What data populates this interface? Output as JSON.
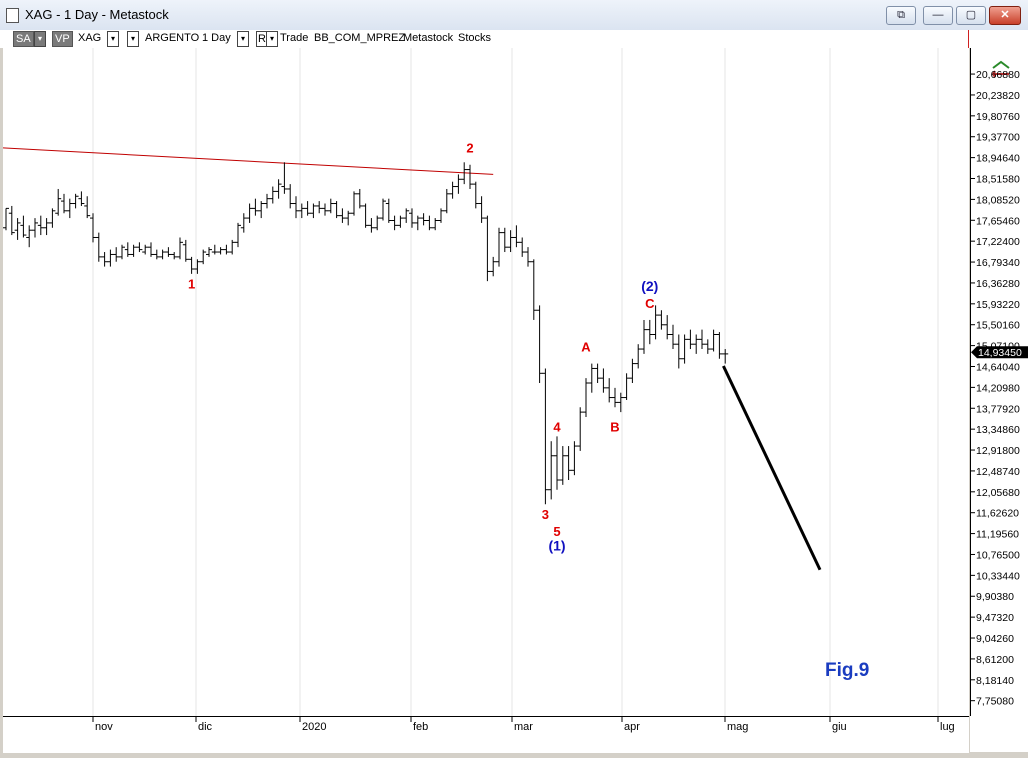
{
  "window": {
    "title": "XAG - 1 Day - Metastock",
    "buttons": [
      "⧉",
      "—",
      "▢",
      "✕"
    ]
  },
  "toolbar": {
    "sa": "SA",
    "vp": "VP",
    "symbol": "XAG",
    "name": "ARGENTO",
    "period": "1 Day",
    "r": "R",
    "trade": "Trade",
    "layout": "BB_COM_MPREZ",
    "source": "Metastock",
    "type": "Stocks"
  },
  "chart_data": {
    "type": "ohlc",
    "title": "",
    "y_ticks": [
      "20,66880",
      "20,23820",
      "19,80760",
      "19,37700",
      "18,94640",
      "18,51580",
      "18,08520",
      "17,65460",
      "17,22400",
      "16,79340",
      "16,36280",
      "15,93220",
      "15,50160",
      "15,07100",
      "14,64040",
      "14,20980",
      "13,77920",
      "13,34860",
      "12,91800",
      "12,48740",
      "12,05680",
      "11,62620",
      "11,19560",
      "10,76500",
      "10,33440",
      "9,90380",
      "9,47320",
      "9,04260",
      "8,61200",
      "8,18140",
      "7,75080"
    ],
    "ylim": [
      7.6,
      21.0
    ],
    "current_price": "14,93450",
    "x_labels": [
      "nov",
      "dic",
      "2020",
      "feb",
      "mar",
      "apr",
      "mag",
      "giu",
      "lug"
    ],
    "bars": [
      [
        17.5,
        17.9,
        17.45,
        17.9
      ],
      [
        17.8,
        17.95,
        17.35,
        17.4
      ],
      [
        17.45,
        17.7,
        17.25,
        17.6
      ],
      [
        17.55,
        17.75,
        17.3,
        17.35
      ],
      [
        17.3,
        17.55,
        17.1,
        17.45
      ],
      [
        17.45,
        17.7,
        17.3,
        17.6
      ],
      [
        17.55,
        17.75,
        17.35,
        17.5
      ],
      [
        17.5,
        17.7,
        17.35,
        17.6
      ],
      [
        17.6,
        17.9,
        17.5,
        17.85
      ],
      [
        17.8,
        18.3,
        17.75,
        18.1
      ],
      [
        18.05,
        18.2,
        17.8,
        17.85
      ],
      [
        17.85,
        18.1,
        17.7,
        18.0
      ],
      [
        18.0,
        18.2,
        17.9,
        18.15
      ],
      [
        18.1,
        18.25,
        17.95,
        18.0
      ],
      [
        17.95,
        18.15,
        17.7,
        17.75
      ],
      [
        17.7,
        17.8,
        17.2,
        17.3
      ],
      [
        17.3,
        17.4,
        16.8,
        16.9
      ],
      [
        16.9,
        17.0,
        16.7,
        16.8
      ],
      [
        16.8,
        17.05,
        16.7,
        16.95
      ],
      [
        16.95,
        17.1,
        16.8,
        16.9
      ],
      [
        16.9,
        17.15,
        16.85,
        17.1
      ],
      [
        17.05,
        17.2,
        16.9,
        16.95
      ],
      [
        16.95,
        17.15,
        16.9,
        17.1
      ],
      [
        17.1,
        17.2,
        17.0,
        17.05
      ],
      [
        17.0,
        17.15,
        16.95,
        17.1
      ],
      [
        17.1,
        17.2,
        16.9,
        16.95
      ],
      [
        16.95,
        17.05,
        16.85,
        16.9
      ],
      [
        16.9,
        17.05,
        16.85,
        17.0
      ],
      [
        17.0,
        17.1,
        16.9,
        16.95
      ],
      [
        16.95,
        17.0,
        16.85,
        16.9
      ],
      [
        16.9,
        17.3,
        16.85,
        17.2
      ],
      [
        17.15,
        17.25,
        16.8,
        16.85
      ],
      [
        16.85,
        16.9,
        16.55,
        16.65
      ],
      [
        16.65,
        16.85,
        16.55,
        16.8
      ],
      [
        16.8,
        17.05,
        16.75,
        17.0
      ],
      [
        16.95,
        17.1,
        16.9,
        17.05
      ],
      [
        17.0,
        17.15,
        16.95,
        17.0
      ],
      [
        17.0,
        17.1,
        16.95,
        17.05
      ],
      [
        17.05,
        17.15,
        16.95,
        17.0
      ],
      [
        17.0,
        17.25,
        16.95,
        17.2
      ],
      [
        17.2,
        17.6,
        17.1,
        17.55
      ],
      [
        17.5,
        17.8,
        17.4,
        17.7
      ],
      [
        17.7,
        18.0,
        17.6,
        17.9
      ],
      [
        17.9,
        18.1,
        17.75,
        17.85
      ],
      [
        17.85,
        18.05,
        17.7,
        18.0
      ],
      [
        18.0,
        18.2,
        17.9,
        18.1
      ],
      [
        18.1,
        18.35,
        18.0,
        18.25
      ],
      [
        18.25,
        18.5,
        18.1,
        18.4
      ],
      [
        18.35,
        18.85,
        18.2,
        18.3
      ],
      [
        18.3,
        18.4,
        17.9,
        18.0
      ],
      [
        18.0,
        18.15,
        17.7,
        17.85
      ],
      [
        17.85,
        18.0,
        17.7,
        17.9
      ],
      [
        17.9,
        18.05,
        17.75,
        17.8
      ],
      [
        17.8,
        18.0,
        17.7,
        17.95
      ],
      [
        17.95,
        18.05,
        17.8,
        17.9
      ],
      [
        17.9,
        18.0,
        17.75,
        17.85
      ],
      [
        17.85,
        18.1,
        17.8,
        18.0
      ],
      [
        18.0,
        18.05,
        17.7,
        17.75
      ],
      [
        17.75,
        17.9,
        17.6,
        17.7
      ],
      [
        17.7,
        17.85,
        17.55,
        17.8
      ],
      [
        17.8,
        18.25,
        17.75,
        18.2
      ],
      [
        18.2,
        18.3,
        17.9,
        17.95
      ],
      [
        17.95,
        18.0,
        17.5,
        17.55
      ],
      [
        17.55,
        17.7,
        17.4,
        17.5
      ],
      [
        17.5,
        17.75,
        17.45,
        17.7
      ],
      [
        17.7,
        18.1,
        17.65,
        18.05
      ],
      [
        18.0,
        18.1,
        17.6,
        17.65
      ],
      [
        17.65,
        17.75,
        17.45,
        17.55
      ],
      [
        17.55,
        17.75,
        17.5,
        17.7
      ],
      [
        17.7,
        17.9,
        17.6,
        17.85
      ],
      [
        17.8,
        17.9,
        17.5,
        17.6
      ],
      [
        17.6,
        17.75,
        17.45,
        17.7
      ],
      [
        17.7,
        17.8,
        17.55,
        17.65
      ],
      [
        17.65,
        17.75,
        17.45,
        17.5
      ],
      [
        17.5,
        17.7,
        17.45,
        17.65
      ],
      [
        17.65,
        17.9,
        17.6,
        17.85
      ],
      [
        17.85,
        18.3,
        17.8,
        18.2
      ],
      [
        18.2,
        18.45,
        18.1,
        18.35
      ],
      [
        18.35,
        18.6,
        18.2,
        18.5
      ],
      [
        18.5,
        18.85,
        18.4,
        18.7
      ],
      [
        18.7,
        18.8,
        18.3,
        18.4
      ],
      [
        18.4,
        18.45,
        17.9,
        18.0
      ],
      [
        18.0,
        18.15,
        17.6,
        17.7
      ],
      [
        17.7,
        17.75,
        16.4,
        16.6
      ],
      [
        16.6,
        16.9,
        16.5,
        16.8
      ],
      [
        16.8,
        17.5,
        16.7,
        17.4
      ],
      [
        17.4,
        17.5,
        17.0,
        17.1
      ],
      [
        17.1,
        17.45,
        17.0,
        17.3
      ],
      [
        17.3,
        17.55,
        17.1,
        17.2
      ],
      [
        17.2,
        17.3,
        16.9,
        17.0
      ],
      [
        17.0,
        17.1,
        16.7,
        16.8
      ],
      [
        16.8,
        16.85,
        15.6,
        15.8
      ],
      [
        15.8,
        15.9,
        14.3,
        14.5
      ],
      [
        14.5,
        14.6,
        11.8,
        12.1
      ],
      [
        12.1,
        13.1,
        11.9,
        12.8
      ],
      [
        12.8,
        13.2,
        12.1,
        12.3
      ],
      [
        12.3,
        13.0,
        12.2,
        12.8
      ],
      [
        12.8,
        13.0,
        12.3,
        12.5
      ],
      [
        12.5,
        13.1,
        12.4,
        13.0
      ],
      [
        13.0,
        13.8,
        12.9,
        13.7
      ],
      [
        13.7,
        14.4,
        13.6,
        14.3
      ],
      [
        14.3,
        14.7,
        14.1,
        14.6
      ],
      [
        14.6,
        14.7,
        14.3,
        14.4
      ],
      [
        14.4,
        14.6,
        14.1,
        14.2
      ],
      [
        14.2,
        14.4,
        13.9,
        14.0
      ],
      [
        14.0,
        14.2,
        13.8,
        13.9
      ],
      [
        13.9,
        14.1,
        13.7,
        14.0
      ],
      [
        14.0,
        14.5,
        13.95,
        14.4
      ],
      [
        14.4,
        14.8,
        14.3,
        14.7
      ],
      [
        14.7,
        15.1,
        14.6,
        15.0
      ],
      [
        15.0,
        15.6,
        14.9,
        15.4
      ],
      [
        15.4,
        15.6,
        15.1,
        15.3
      ],
      [
        15.3,
        15.9,
        15.2,
        15.7
      ],
      [
        15.7,
        15.8,
        15.4,
        15.5
      ],
      [
        15.5,
        15.7,
        15.2,
        15.3
      ],
      [
        15.3,
        15.5,
        15.0,
        15.1
      ],
      [
        15.1,
        15.3,
        14.6,
        14.8
      ],
      [
        14.8,
        15.3,
        14.7,
        15.2
      ],
      [
        15.2,
        15.4,
        15.0,
        15.1
      ],
      [
        15.1,
        15.3,
        14.9,
        15.2
      ],
      [
        15.2,
        15.4,
        15.0,
        15.1
      ],
      [
        15.1,
        15.2,
        14.9,
        15.0
      ],
      [
        15.0,
        15.4,
        14.95,
        15.3
      ],
      [
        15.3,
        15.35,
        14.8,
        14.9
      ],
      [
        14.9,
        15.0,
        14.7,
        14.9
      ]
    ],
    "annotations": [
      {
        "text": "1",
        "color": "#e00000",
        "x_bar": 32,
        "y": 16.25
      },
      {
        "text": "2",
        "color": "#e00000",
        "x_bar": 80,
        "y": 19.05
      },
      {
        "text": "3",
        "color": "#e00000",
        "x_bar": 93,
        "y": 11.5
      },
      {
        "text": "4",
        "color": "#e00000",
        "x_bar": 95,
        "y": 13.3
      },
      {
        "text": "5",
        "color": "#e00000",
        "x_bar": 95,
        "y": 11.15
      },
      {
        "text": "(1)",
        "color": "#1010c0",
        "x_bar": 95,
        "y": 10.85
      },
      {
        "text": "A",
        "color": "#e00000",
        "x_bar": 100,
        "y": 14.95
      },
      {
        "text": "B",
        "color": "#e00000",
        "x_bar": 105,
        "y": 13.3
      },
      {
        "text": "C",
        "color": "#e00000",
        "x_bar": 111,
        "y": 15.85
      },
      {
        "text": "(2)",
        "color": "#1010c0",
        "x_bar": 111,
        "y": 16.2
      }
    ],
    "trendline": {
      "color": "#c00000",
      "x1_bar": -1,
      "y1": 19.15,
      "x2_bar": 84,
      "y2": 18.6
    },
    "projection": {
      "color": "#000000",
      "x1_bar": 123,
      "y1": 14.65,
      "y2": 10.45
    },
    "fig_label": "Fig.9"
  }
}
